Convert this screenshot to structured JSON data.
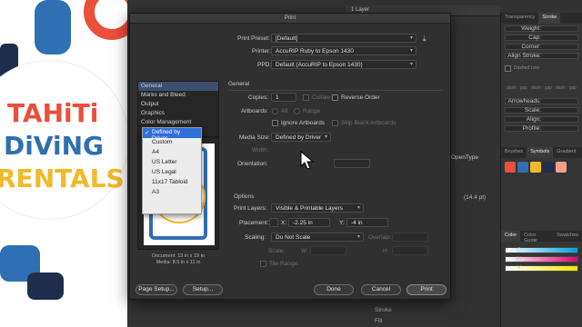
{
  "dialog": {
    "title": "Print",
    "print_preset_label": "Print Preset:",
    "print_preset_value": "[Default]",
    "printer_label": "Printer:",
    "printer_value": "AccuRIP Ruby to Epson 1430",
    "ppd_label": "PPD:",
    "ppd_value": "Default (AccuRIP to Epson 1430)",
    "section_general": "General",
    "copies_label": "Copies:",
    "copies_value": "1",
    "collate_label": "Collate",
    "reverse_order_label": "Reverse Order",
    "artboards_label": "Artboards:",
    "all_label": "All",
    "range_label": "Range",
    "ignore_artboards_label": "Ignore Artboards",
    "skip_blank_label": "Skip Blank Artboards",
    "media_size_label": "Media Size:",
    "media_size_value": "Defined by Driver",
    "width_label": "Width:",
    "orientation_label": "Orientation:",
    "section_options": "Options",
    "print_layers_label": "Print Layers:",
    "print_layers_value": "Visible & Printable Layers",
    "placement_label": "Placement:",
    "x_label": "X:",
    "x_value": "-2.25 in",
    "y_label": "Y:",
    "y_value": "-4 in",
    "scaling_label": "Scaling:",
    "scaling_value": "Do Not Scale",
    "overlap_label": "Overlap:",
    "scale_label": "Scale:",
    "w_label": "W:",
    "h_label": "H:",
    "tile_range_label": "Tile Range:",
    "sidebar": [
      "General",
      "Marks and Bleed",
      "Output",
      "Graphics",
      "Color Management"
    ],
    "doc_info": "Document: 13 in x 19 in",
    "media_info": "Media: 8.5 in x 11 in",
    "page_setup_label": "Page Setup...",
    "setup_label": "Setup...",
    "done_label": "Done",
    "cancel_label": "Cancel",
    "print_label": "Print"
  },
  "media_dropdown": {
    "items": [
      "Defined by Driver",
      "Custom",
      "A4",
      "US Letter",
      "US Legal",
      "11x17 Tabloid",
      "A3"
    ],
    "selected": "Defined by Driver",
    "check_glyph": "✓"
  },
  "app": {
    "layers_tab": "1 Layer",
    "panel_tabs": [
      "Transparency",
      "Stroke"
    ],
    "stroke_rows": [
      "Weight:",
      "Cap:",
      "Corner:",
      "Align Stroke:"
    ],
    "dashed_line": "Dashed Line",
    "dash_labels": [
      "dash",
      "gap",
      "dash",
      "gap",
      "dash",
      "gap"
    ],
    "arrowheads_label": "Arrowheads:",
    "scale_label": "Scale:",
    "align_label": "Align:",
    "profile_label": "Profile:",
    "opentype_label": "OpenType",
    "brush_tabs": [
      "Brushes",
      "Symbols",
      "Gradient"
    ],
    "color_tabs": [
      "Color",
      "Color Guide",
      "Swatches"
    ],
    "color_channels": [
      "C",
      "M",
      "Y",
      "K"
    ],
    "point_size": "(14.4 pt)",
    "stroke_layer": "Stroke",
    "fill_layer": "Fill"
  },
  "artwork": {
    "line1": "TAHiTi",
    "line2": "DiViNG",
    "line3": "RENTALS",
    "colors": {
      "red": "#e94f3a",
      "blue": "#2f6fb3",
      "yellow": "#f2b928"
    }
  }
}
